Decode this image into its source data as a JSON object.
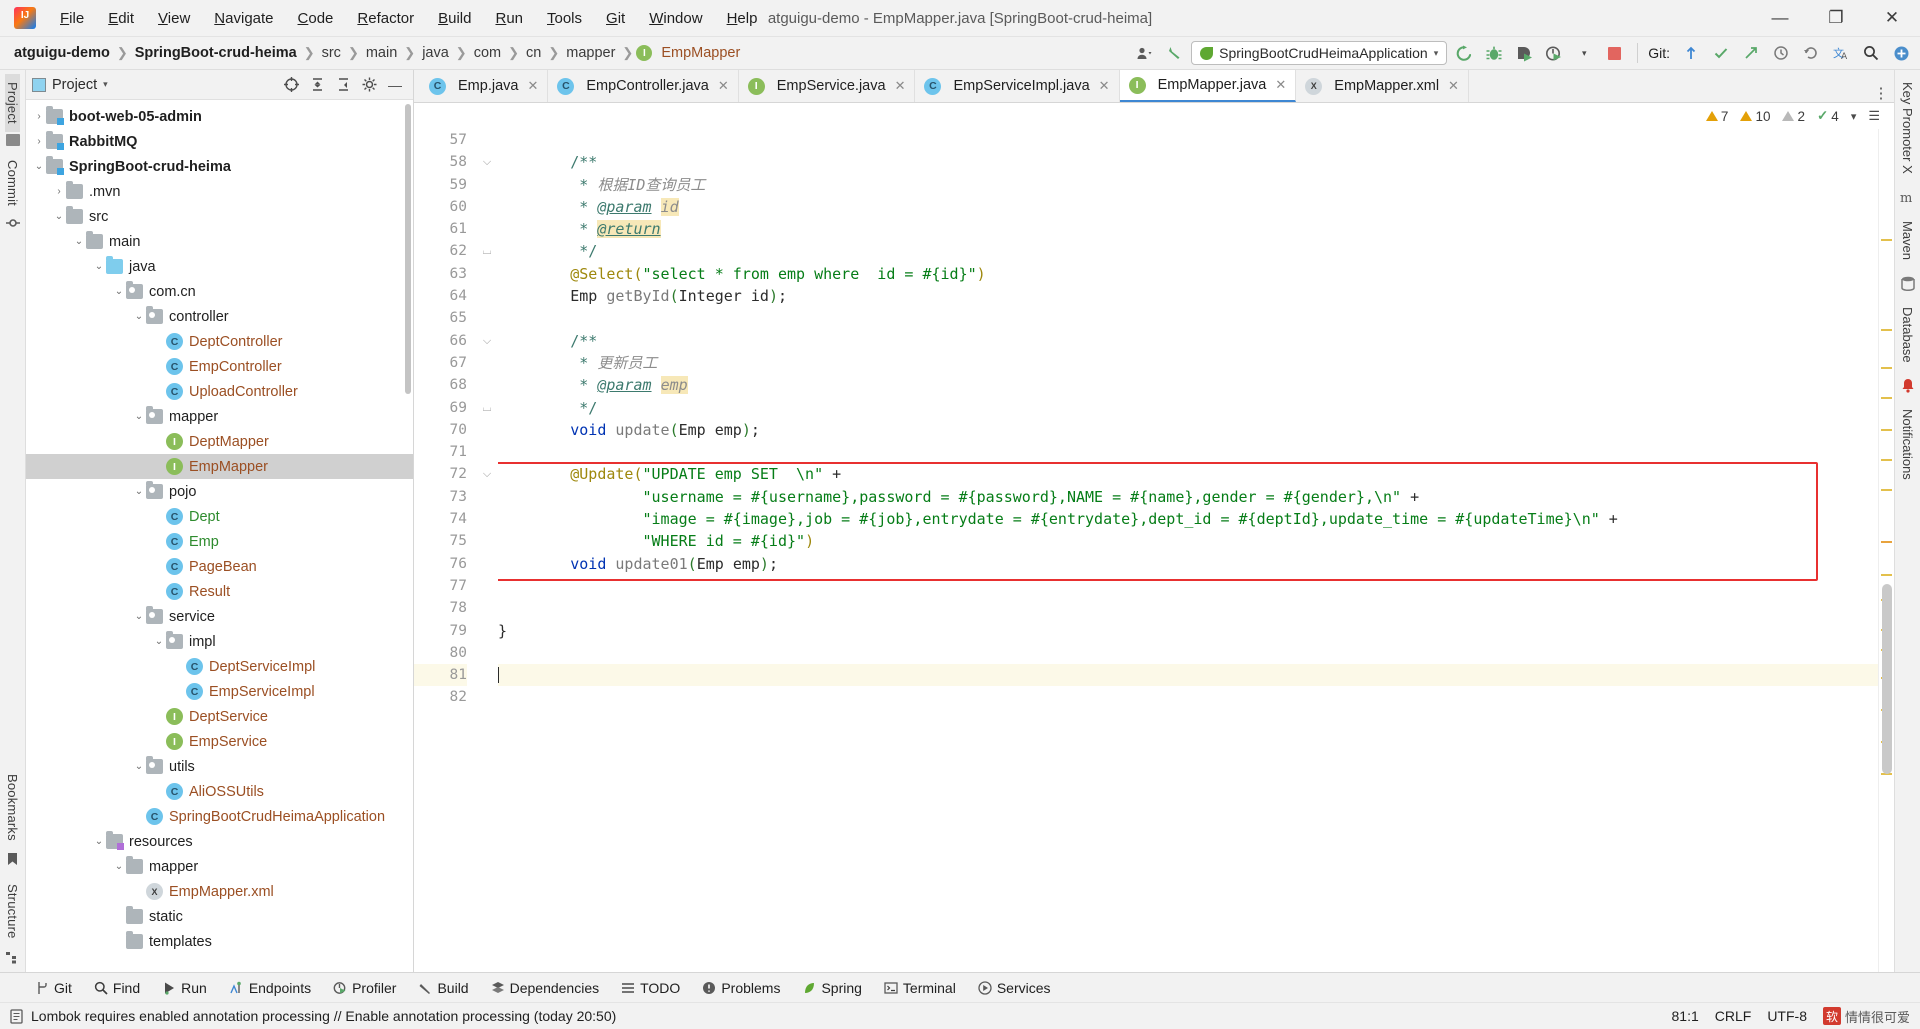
{
  "window": {
    "title": "atguigu-demo - EmpMapper.java [SpringBoot-crud-heima]",
    "minimize": "—",
    "maximize": "❐",
    "close": "✕"
  },
  "menu": [
    {
      "label": "File"
    },
    {
      "label": "Edit"
    },
    {
      "label": "View"
    },
    {
      "label": "Navigate"
    },
    {
      "label": "Code"
    },
    {
      "label": "Refactor"
    },
    {
      "label": "Build"
    },
    {
      "label": "Run"
    },
    {
      "label": "Tools"
    },
    {
      "label": "Git"
    },
    {
      "label": "Window"
    },
    {
      "label": "Help"
    }
  ],
  "breadcrumbs": [
    {
      "label": "atguigu-demo",
      "style": "bold"
    },
    {
      "label": "SpringBoot-crud-heima",
      "style": "bold"
    },
    {
      "label": "src",
      "style": "normal"
    },
    {
      "label": "main",
      "style": "normal"
    },
    {
      "label": "java",
      "style": "normal"
    },
    {
      "label": "com",
      "style": "normal"
    },
    {
      "label": "cn",
      "style": "normal"
    },
    {
      "label": "mapper",
      "style": "normal"
    },
    {
      "label": "EmpMapper",
      "style": "class",
      "badge": "I"
    }
  ],
  "toolbar": {
    "run_config": "SpringBootCrudHeimaApplication",
    "run_config_caret": "▾",
    "git_label": "Git:",
    "icons": [
      "user-settings-icon",
      "back-arrow-icon",
      "rerun-icon",
      "debug-icon",
      "run-with-coverage-icon",
      "profiler-icon",
      "stop-icon",
      "git-update-icon",
      "git-commit-icon",
      "git-push-icon",
      "git-history-icon",
      "git-rollback-icon",
      "translate-icon",
      "search-icon",
      "settings-plugin-icon"
    ]
  },
  "project_panel": {
    "title": "Project",
    "caret": "▾",
    "header_icons": [
      "scope-icon",
      "collapse-all-icon",
      "select-opened-file-icon",
      "settings-icon",
      "hide-icon"
    ],
    "tree": [
      {
        "indent": 1,
        "arrow": "›",
        "icon": "folder-module",
        "label": "boot-web-05-admin",
        "style": "bold"
      },
      {
        "indent": 1,
        "arrow": "›",
        "icon": "folder-module",
        "label": "RabbitMQ",
        "style": "bold"
      },
      {
        "indent": 1,
        "arrow": "⌄",
        "icon": "folder-module",
        "label": "SpringBoot-crud-heima",
        "style": "bold"
      },
      {
        "indent": 2,
        "arrow": "›",
        "icon": "folder",
        "label": ".mvn",
        "style": "normal"
      },
      {
        "indent": 2,
        "arrow": "⌄",
        "icon": "folder",
        "label": "src",
        "style": "normal"
      },
      {
        "indent": 3,
        "arrow": "⌄",
        "icon": "folder",
        "label": "main",
        "style": "normal"
      },
      {
        "indent": 4,
        "arrow": "⌄",
        "icon": "folder-java",
        "label": "java",
        "style": "normal"
      },
      {
        "indent": 5,
        "arrow": "⌄",
        "icon": "folder-package",
        "label": "com.cn",
        "style": "normal"
      },
      {
        "indent": 6,
        "arrow": "⌄",
        "icon": "folder-package",
        "label": "controller",
        "style": "normal"
      },
      {
        "indent": 7,
        "arrow": "",
        "icon": "class-badge",
        "label": "DeptController",
        "style": "red"
      },
      {
        "indent": 7,
        "arrow": "",
        "icon": "class-badge",
        "label": "EmpController",
        "style": "red"
      },
      {
        "indent": 7,
        "arrow": "",
        "icon": "class-badge",
        "label": "UploadController",
        "style": "red"
      },
      {
        "indent": 6,
        "arrow": "⌄",
        "icon": "folder-package",
        "label": "mapper",
        "style": "normal"
      },
      {
        "indent": 7,
        "arrow": "",
        "icon": "interface-badge",
        "label": "DeptMapper",
        "style": "red"
      },
      {
        "indent": 7,
        "arrow": "",
        "icon": "interface-badge",
        "label": "EmpMapper",
        "style": "red",
        "selected": true
      },
      {
        "indent": 6,
        "arrow": "⌄",
        "icon": "folder-package",
        "label": "pojo",
        "style": "normal"
      },
      {
        "indent": 7,
        "arrow": "",
        "icon": "class-badge",
        "label": "Dept",
        "style": "green"
      },
      {
        "indent": 7,
        "arrow": "",
        "icon": "class-badge",
        "label": "Emp",
        "style": "green"
      },
      {
        "indent": 7,
        "arrow": "",
        "icon": "class-badge",
        "label": "PageBean",
        "style": "red"
      },
      {
        "indent": 7,
        "arrow": "",
        "icon": "class-badge",
        "label": "Result",
        "style": "red"
      },
      {
        "indent": 6,
        "arrow": "⌄",
        "icon": "folder-package",
        "label": "service",
        "style": "normal"
      },
      {
        "indent": 7,
        "arrow": "⌄",
        "icon": "folder-package",
        "label": "impl",
        "style": "normal"
      },
      {
        "indent": 8,
        "arrow": "",
        "icon": "class-badge",
        "label": "DeptServiceImpl",
        "style": "red"
      },
      {
        "indent": 8,
        "arrow": "",
        "icon": "class-badge",
        "label": "EmpServiceImpl",
        "style": "red"
      },
      {
        "indent": 7,
        "arrow": "",
        "icon": "interface-badge",
        "label": "DeptService",
        "style": "red"
      },
      {
        "indent": 7,
        "arrow": "",
        "icon": "interface-badge",
        "label": "EmpService",
        "style": "red"
      },
      {
        "indent": 6,
        "arrow": "⌄",
        "icon": "folder-package",
        "label": "utils",
        "style": "normal"
      },
      {
        "indent": 7,
        "arrow": "",
        "icon": "class-badge",
        "label": "AliOSSUtils",
        "style": "red"
      },
      {
        "indent": 6,
        "arrow": "",
        "icon": "class-badge",
        "label": "SpringBootCrudHeimaApplication",
        "style": "red"
      },
      {
        "indent": 4,
        "arrow": "⌄",
        "icon": "folder-resources",
        "label": "resources",
        "style": "normal"
      },
      {
        "indent": 5,
        "arrow": "⌄",
        "icon": "folder",
        "label": "mapper",
        "style": "normal"
      },
      {
        "indent": 6,
        "arrow": "",
        "icon": "xml-badge",
        "label": "EmpMapper.xml",
        "style": "red"
      },
      {
        "indent": 5,
        "arrow": "",
        "icon": "folder",
        "label": "static",
        "style": "normal"
      },
      {
        "indent": 5,
        "arrow": "",
        "icon": "folder",
        "label": "templates",
        "style": "normal"
      }
    ]
  },
  "editor_tabs": [
    {
      "label": "Emp.java",
      "icon": "class-badge",
      "active": false
    },
    {
      "label": "EmpController.java",
      "icon": "class-badge",
      "active": false
    },
    {
      "label": "EmpService.java",
      "icon": "interface-badge",
      "active": false
    },
    {
      "label": "EmpServiceImpl.java",
      "icon": "class-badge",
      "active": false
    },
    {
      "label": "EmpMapper.java",
      "icon": "interface-badge",
      "active": true
    },
    {
      "label": "EmpMapper.xml",
      "icon": "xml-badge",
      "active": false
    }
  ],
  "inspections": [
    {
      "icon": "warning-triangle",
      "count": "7",
      "kind": "warn"
    },
    {
      "icon": "warning-triangle",
      "count": "10",
      "kind": "warn"
    },
    {
      "icon": "weak-warning-triangle",
      "count": "2",
      "kind": "weak"
    },
    {
      "icon": "check-mark",
      "count": "4",
      "kind": "ok"
    }
  ],
  "code": {
    "first_line": 57,
    "last_line": 82,
    "cursor_line": 81,
    "lines": [
      {
        "n": 57,
        "html": ""
      },
      {
        "n": 58,
        "html": "        <span class=\"jd\">/**</span>",
        "fold": "open"
      },
      {
        "n": 59,
        "html": "         <span class=\"jd\">* </span><span class=\"cm\">根据ID查询员工</span>"
      },
      {
        "n": 60,
        "html": "         <span class=\"jd\">* </span><span class=\"jdtag\">@param</span> <span class=\"hl cm\">id</span>"
      },
      {
        "n": 61,
        "html": "         <span class=\"jd\">* </span><span class=\"jdtag hl\">@return</span>"
      },
      {
        "n": 62,
        "html": "         <span class=\"jd\">*/</span>",
        "fold": "close"
      },
      {
        "n": 63,
        "html": "        <span class=\"a\">@Select(</span><span class=\"s\">\"select * from emp where  id = #{id}\"</span><span class=\"a\">)</span>"
      },
      {
        "n": 64,
        "html": "        <span class=\"t\">Emp</span> <span class=\"m\">getById</span><span class=\"paren\">(</span><span class=\"t\">Integer</span> <span class=\"p\">id</span><span class=\"paren\">)</span>;"
      },
      {
        "n": 65,
        "html": ""
      },
      {
        "n": 66,
        "html": "        <span class=\"jd\">/**</span>",
        "fold": "open"
      },
      {
        "n": 67,
        "html": "         <span class=\"jd\">* </span><span class=\"cm\">更新员工</span>"
      },
      {
        "n": 68,
        "html": "         <span class=\"jd\">* </span><span class=\"jdtag\">@param</span> <span class=\"hl cm\">emp</span>"
      },
      {
        "n": 69,
        "html": "         <span class=\"jd\">*/</span>",
        "fold": "close"
      },
      {
        "n": 70,
        "html": "        <span class=\"k\">void</span> <span class=\"m\">update</span><span class=\"paren\">(</span><span class=\"t\">Emp</span> <span class=\"p\">emp</span><span class=\"paren\">)</span>;"
      },
      {
        "n": 71,
        "html": ""
      },
      {
        "n": 72,
        "html": "        <span class=\"a\">@Update(</span><span class=\"s\">\"UPDATE emp SET  \\n\"</span> <span class=\"p\">+</span>",
        "fold": "open"
      },
      {
        "n": 73,
        "html": "                <span class=\"s\">\"username = #{username},password = #{password},NAME = #{name},gender = #{gender},\\n\"</span> <span class=\"p\">+</span>"
      },
      {
        "n": 74,
        "html": "                <span class=\"s\">\"image = #{image},job = #{job},entrydate = #{entrydate},dept_id = #{deptId},update_time = #{updateTime}\\n\"</span> <span class=\"p\">+</span>"
      },
      {
        "n": 75,
        "html": "                <span class=\"s\">\"WHERE id = #{id}\"</span><span class=\"a\">)</span>"
      },
      {
        "n": 76,
        "html": "        <span class=\"k\">void</span> <span class=\"m\">update01</span><span class=\"paren\">(</span><span class=\"t\">Emp</span> <span class=\"p\">emp</span><span class=\"paren\">)</span>;"
      },
      {
        "n": 77,
        "html": ""
      },
      {
        "n": 78,
        "html": ""
      },
      {
        "n": 79,
        "html": "<span class=\"p\">}</span>"
      },
      {
        "n": 80,
        "html": ""
      },
      {
        "n": 81,
        "html": "<span class=\"caret-bar\"></span>",
        "current": true
      },
      {
        "n": 82,
        "html": ""
      }
    ]
  },
  "bottom_tools": [
    {
      "label": "Git",
      "icon": "git-branch-icon"
    },
    {
      "label": "Find",
      "icon": "search-icon"
    },
    {
      "label": "Run",
      "icon": "run-icon"
    },
    {
      "label": "Endpoints",
      "icon": "endpoints-icon"
    },
    {
      "label": "Profiler",
      "icon": "profiler-icon"
    },
    {
      "label": "Build",
      "icon": "build-hammer-icon"
    },
    {
      "label": "Dependencies",
      "icon": "dependencies-icon"
    },
    {
      "label": "TODO",
      "icon": "todo-list-icon"
    },
    {
      "label": "Problems",
      "icon": "problems-icon"
    },
    {
      "label": "Spring",
      "icon": "spring-leaf-icon"
    },
    {
      "label": "Terminal",
      "icon": "terminal-icon"
    },
    {
      "label": "Services",
      "icon": "services-icon"
    }
  ],
  "status": {
    "message": "Lombok requires enabled annotation processing // Enable annotation processing (today 20:50)",
    "message_icon": "notification-icon",
    "caret_position": "81:1",
    "line_separator": "CRLF",
    "encoding": "UTF-8",
    "watermark": "情情很可爱"
  },
  "left_stripe": [
    {
      "label": "Project",
      "active": true
    },
    {
      "label": "Commit",
      "active": false
    },
    {
      "label": "Bookmarks",
      "active": false
    },
    {
      "label": "Structure",
      "active": false
    }
  ],
  "right_stripe": [
    {
      "label": "Key Promoter X"
    },
    {
      "label": "Maven"
    },
    {
      "label": "Database"
    },
    {
      "label": "Notifications"
    }
  ],
  "colors": {
    "accent_blue": "#3e87d3",
    "warning": "#e3a008",
    "error_box": "#e83030",
    "string_green": "#067d17",
    "keyword_blue": "#0033b3",
    "annotation_gold": "#9e880d",
    "javadoc_teal": "#3d7a6e"
  }
}
